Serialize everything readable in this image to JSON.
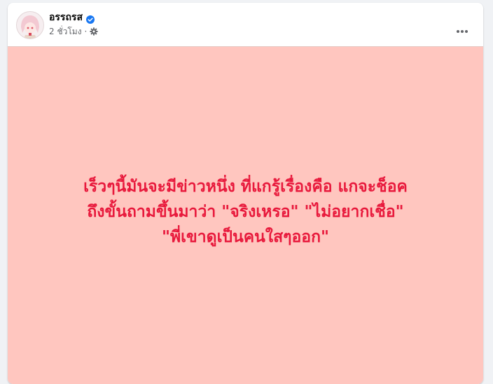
{
  "post": {
    "author": {
      "name": "อรรถรส",
      "verified": true
    },
    "timestamp": "2 ชั่วโมง",
    "separator": "·",
    "privacy_icon": "gear-icon",
    "more_icon": "more-horizontal-icon",
    "image": {
      "background": "#ffc6bf",
      "text_color": "#e8193c",
      "lines": [
        "เร็วๆนี้มันจะมีข่าวหนึ่ง ที่แกรู้เรื่องคือ แกจะช็อค",
        "ถึงขั้นถามขึ้นมาว่า \"จริงเหรอ\" \"ไม่อยากเชื่อ\"",
        "\"พี่เขาดูเป็นคนใสๆออก\""
      ]
    }
  },
  "colors": {
    "verified_badge": "#1877f2",
    "name": "#050505",
    "meta": "#65676b"
  }
}
